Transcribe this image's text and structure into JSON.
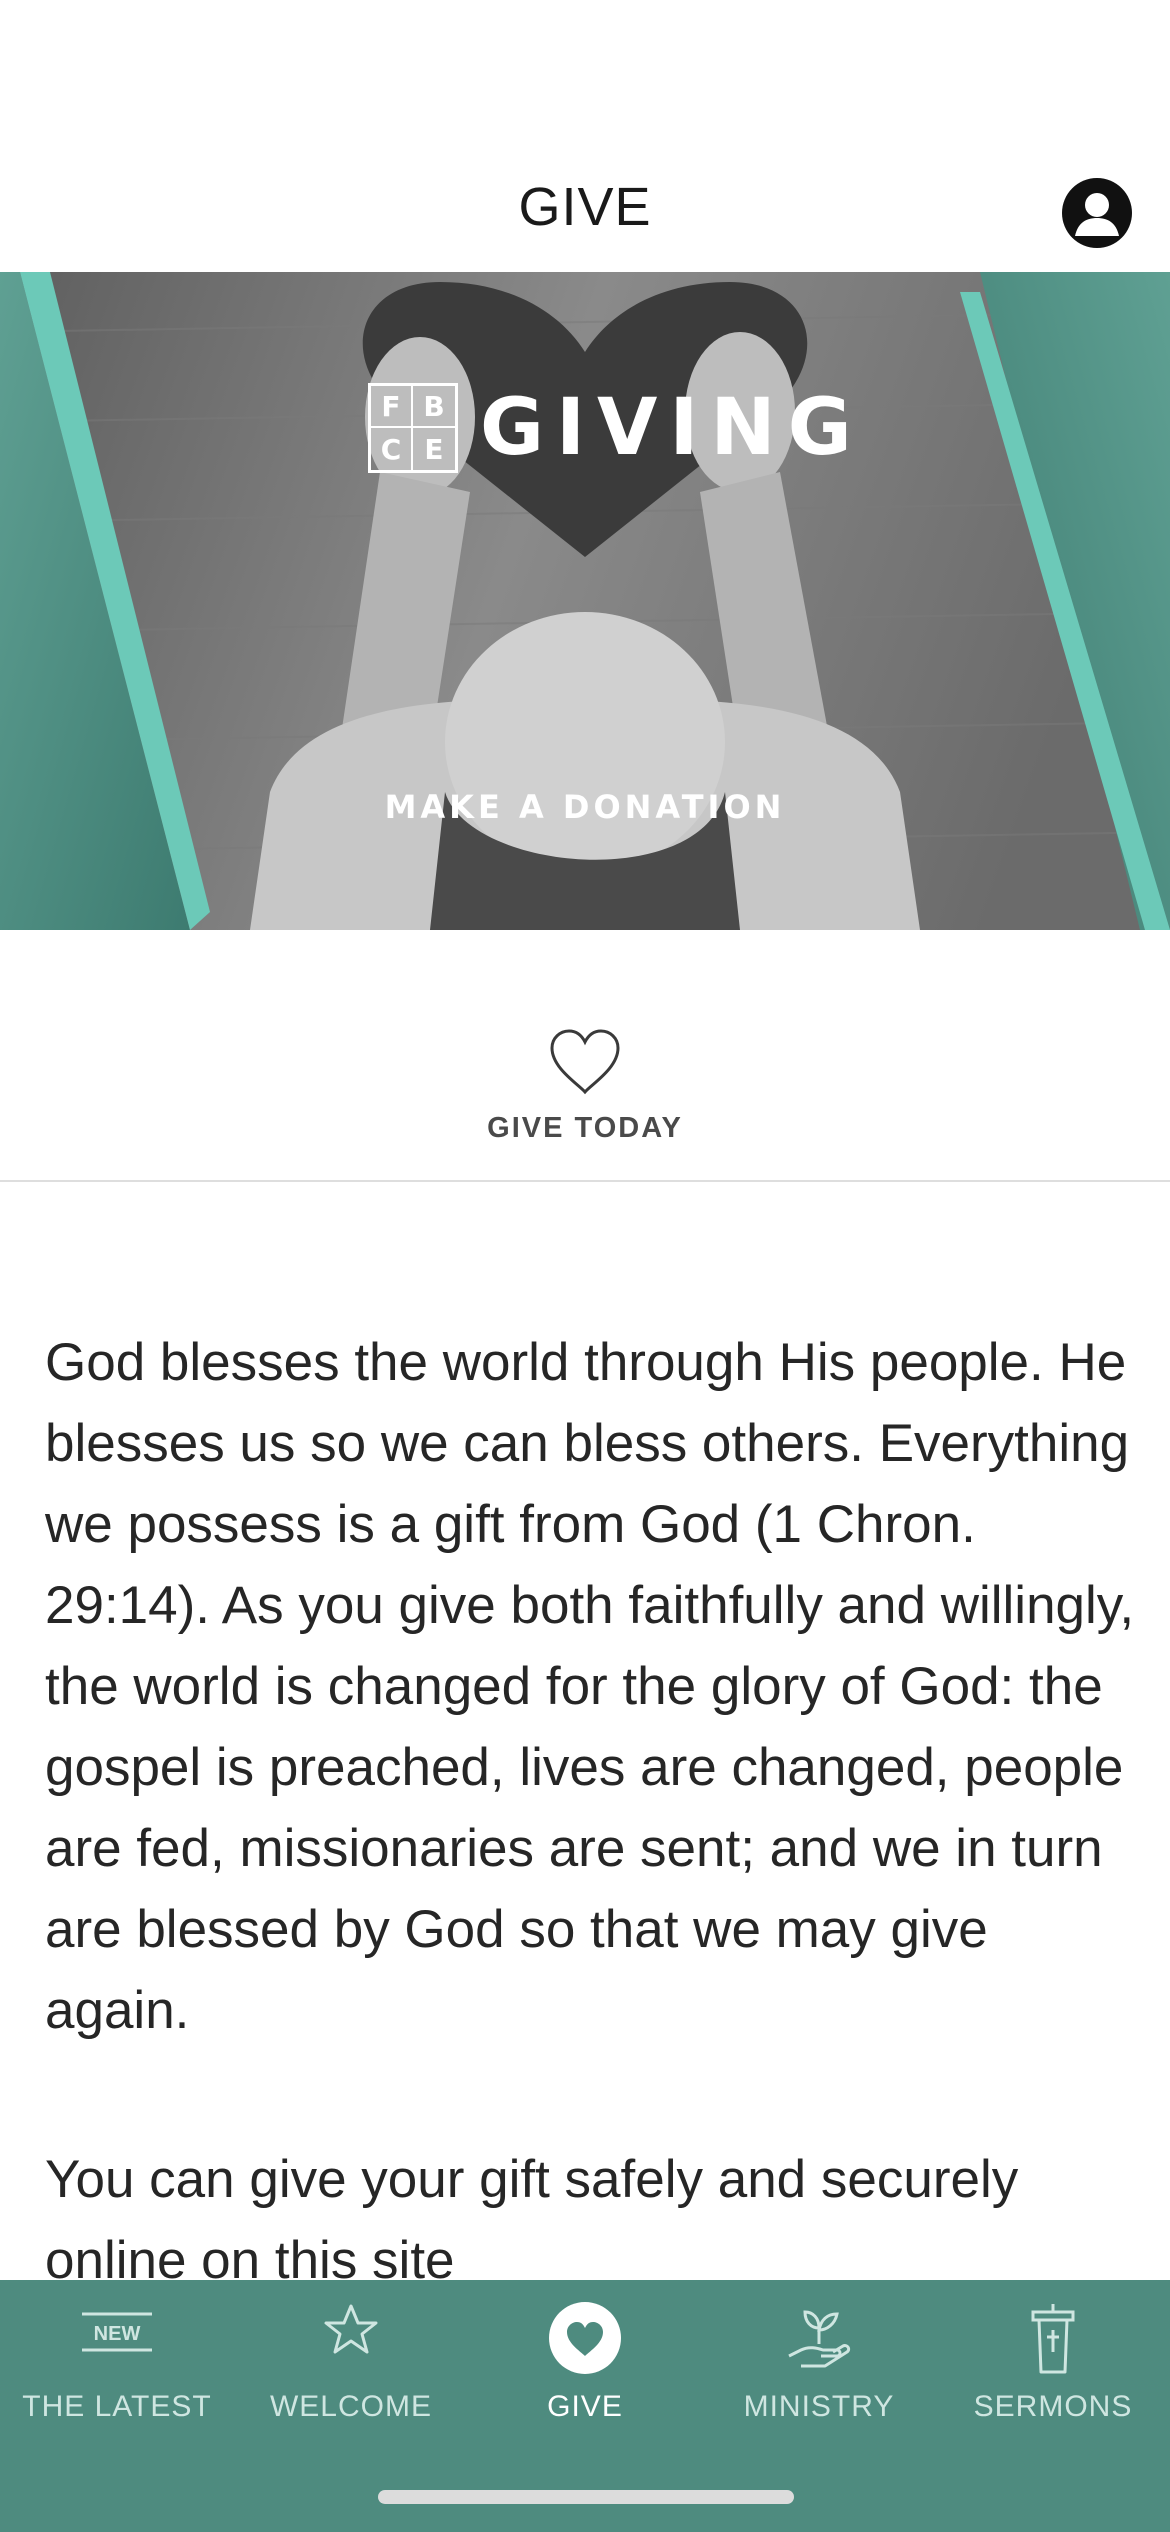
{
  "header": {
    "title": "GIVE",
    "profile_icon": "user-circle-icon"
  },
  "banner": {
    "brand_letters": [
      "F",
      "B",
      "C",
      "E"
    ],
    "brand_word": "GIVING",
    "cta": "MAKE A DONATION",
    "accent_color": "#6cc9b8",
    "panel_color": "#4a8a7f"
  },
  "give_today": {
    "icon": "heart-outline-icon",
    "label": "GIVE TODAY"
  },
  "content": {
    "paragraph_1": "God blesses the world through His people. He blesses us so we can bless others. Everything we possess is a gift from God (1 Chron. 29:14). As you give both faithfully and willingly, the world is changed for the glory of God: the gospel is preached, lives are changed, people are fed, missionaries are sent; and we in turn are blessed by God so that we may give again.",
    "paragraph_2": "You can give your gift safely and securely online on this site"
  },
  "tabbar": {
    "background": "#4e8b7f",
    "tabs": [
      {
        "label": "THE LATEST",
        "icon": "new-badge-icon",
        "badge": "NEW",
        "active": false
      },
      {
        "label": "WELCOME",
        "icon": "star-icon",
        "active": false
      },
      {
        "label": "GIVE",
        "icon": "heart-circle-icon",
        "active": true
      },
      {
        "label": "MINISTRY",
        "icon": "hand-plant-icon",
        "active": false
      },
      {
        "label": "SERMONS",
        "icon": "pulpit-icon",
        "active": false
      }
    ]
  }
}
